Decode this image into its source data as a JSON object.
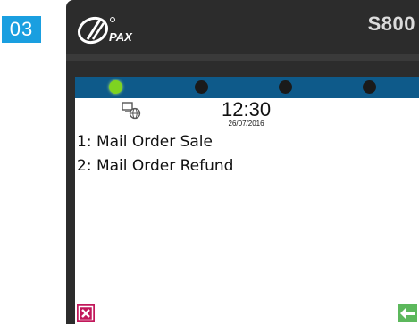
{
  "step": {
    "number": "03"
  },
  "device": {
    "brand": "PAX",
    "model": "S800"
  },
  "status": {
    "leds": [
      {
        "state": "on",
        "color": "#7ed321"
      },
      {
        "state": "off",
        "color": "#1a1a1a"
      },
      {
        "state": "off",
        "color": "#1a1a1a"
      },
      {
        "state": "off",
        "color": "#1a1a1a"
      }
    ],
    "network_icon": "network-globe-icon",
    "time": "12:30",
    "date": "26/07/2016"
  },
  "menu": {
    "items": [
      {
        "label": "1: Mail Order Sale"
      },
      {
        "label": "2: Mail Order Refund"
      }
    ]
  },
  "softkeys": {
    "cancel_icon": "cancel-x-icon",
    "back_icon": "back-arrow-icon"
  },
  "colors": {
    "step_badge": "#1a9fe0",
    "status_bar": "#0e5a8a",
    "terminal_body": "#2c2c2c",
    "cancel_key": "#c2185b",
    "back_key": "#5cb85c"
  }
}
